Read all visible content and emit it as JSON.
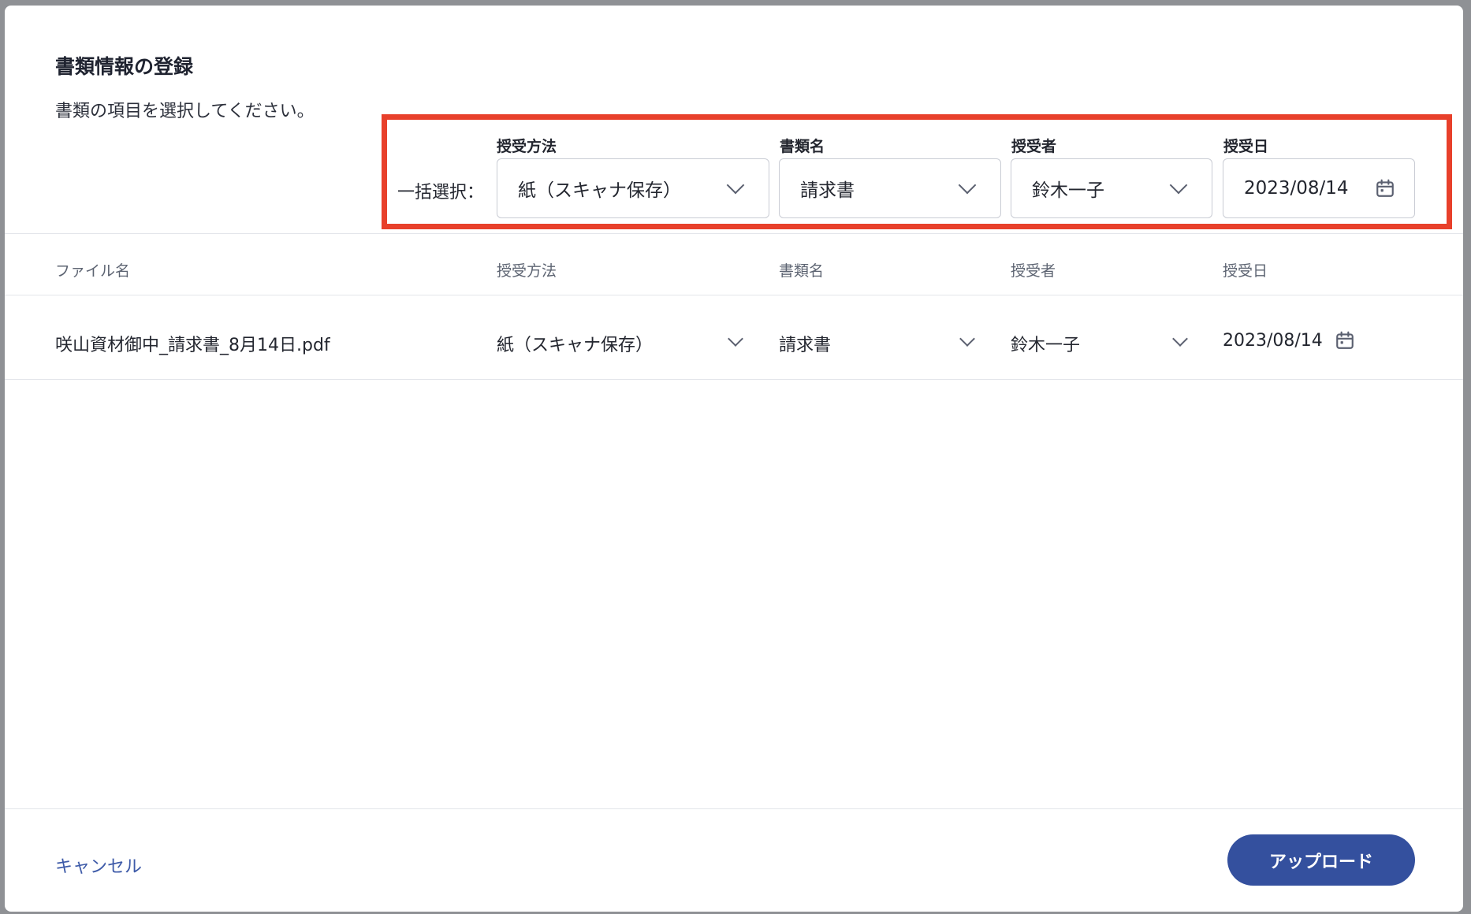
{
  "modal": {
    "title": "書類情報の登録",
    "subtitle": "書類の項目を選択してください。"
  },
  "bulk": {
    "label": "一括選択：",
    "fields": {
      "method": {
        "caption": "授受方法",
        "value": "紙（スキャナ保存）"
      },
      "doc_name": {
        "caption": "書類名",
        "value": "請求書"
      },
      "person": {
        "caption": "授受者",
        "value": "鈴木一子"
      },
      "date": {
        "caption": "授受日",
        "value": "2023/08/14"
      }
    }
  },
  "table": {
    "headers": [
      "ファイル名",
      "授受方法",
      "書類名",
      "授受者",
      "授受日"
    ],
    "rows": [
      {
        "file_name": "咲山資材御中_請求書_8月14日.pdf",
        "method": "紙（スキャナ保存）",
        "doc_name": "請求書",
        "person": "鈴木一子",
        "date": "2023/08/14"
      }
    ]
  },
  "footer": {
    "cancel_label": "キャンセル",
    "upload_label": "アップロード"
  },
  "colors": {
    "highlight": "#e8402b",
    "primary": "#34509e",
    "link": "#3d5aa8"
  },
  "icons": {
    "select": "chevron-down-icon",
    "date": "calendar-icon"
  }
}
